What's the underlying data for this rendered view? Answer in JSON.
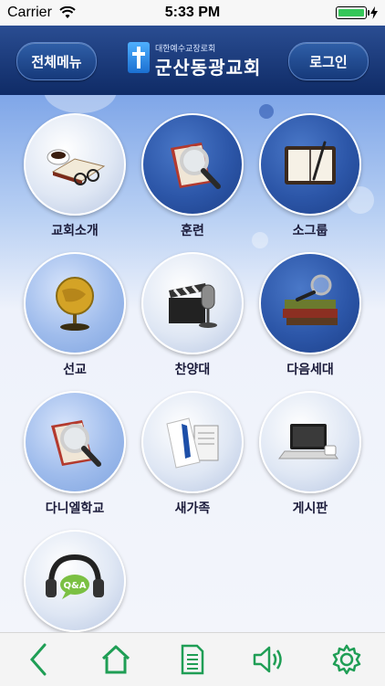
{
  "status_bar": {
    "carrier": "Carrier",
    "time": "5:33 PM"
  },
  "header": {
    "menu_button": "전체메뉴",
    "logo_subtitle": "대한예수교장로회",
    "logo_name": "군산동광교회",
    "login_button": "로그인"
  },
  "menu": [
    {
      "label": "교회소개",
      "icon": "coffee-book-glasses-icon"
    },
    {
      "label": "훈련",
      "icon": "magnifier-book-icon"
    },
    {
      "label": "소그룹",
      "icon": "notebook-pen-icon"
    },
    {
      "label": "선교",
      "icon": "globe-icon"
    },
    {
      "label": "찬양대",
      "icon": "clapper-microphone-icon"
    },
    {
      "label": "다음세대",
      "icon": "books-magnifier-icon"
    },
    {
      "label": "다니엘학교",
      "icon": "book-magnifier-icon"
    },
    {
      "label": "새가족",
      "icon": "shirt-tie-newspaper-icon"
    },
    {
      "label": "게시판",
      "icon": "laptop-cup-icon"
    },
    {
      "label": "",
      "icon": "qa-headset-icon"
    }
  ],
  "toolbar": [
    "back-icon",
    "home-icon",
    "document-icon",
    "speaker-icon",
    "settings-icon"
  ],
  "colors": {
    "accent": "#1f9e55",
    "header": "#1a3a7a"
  }
}
